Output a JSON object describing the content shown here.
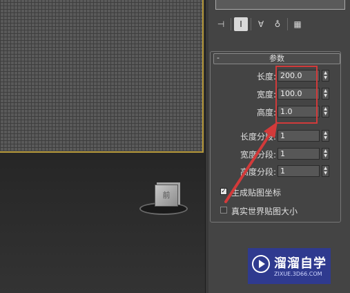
{
  "viewport": {
    "viewcube_label": "前"
  },
  "panel": {
    "tabs": [
      {
        "icon": "pin-stack-icon",
        "glyph": "⊣"
      },
      {
        "icon": "modifier-stack-toggle-icon",
        "glyph": "Ⅰ",
        "active": true
      },
      {
        "icon": "make-unique-icon",
        "glyph": "∀"
      },
      {
        "icon": "remove-modifier-icon",
        "glyph": "♁"
      },
      {
        "icon": "configure-modifier-sets-icon",
        "glyph": "▦"
      }
    ],
    "rollout": {
      "collapse_symbol": "-",
      "title": "参数",
      "fields": [
        {
          "label": "长度:",
          "value": "200.0"
        },
        {
          "label": "宽度:",
          "value": "100.0"
        },
        {
          "label": "高度:",
          "value": "1.0"
        },
        {
          "label": "长度分段:",
          "value": "1"
        },
        {
          "label": "宽度分段:",
          "value": "1"
        },
        {
          "label": "高度分段:",
          "value": "1"
        }
      ],
      "checkboxes": [
        {
          "label": "生成贴图坐标",
          "checked": true
        },
        {
          "label": "真实世界贴图大小",
          "checked": false
        }
      ]
    }
  },
  "watermark": {
    "name": "溜溜自学",
    "url": "ZIXUE.3D66.COM"
  },
  "colors": {
    "highlight": "#d23a3a",
    "viewport_border": "#b89a3a",
    "watermark_bg": "#2f3a8f"
  }
}
